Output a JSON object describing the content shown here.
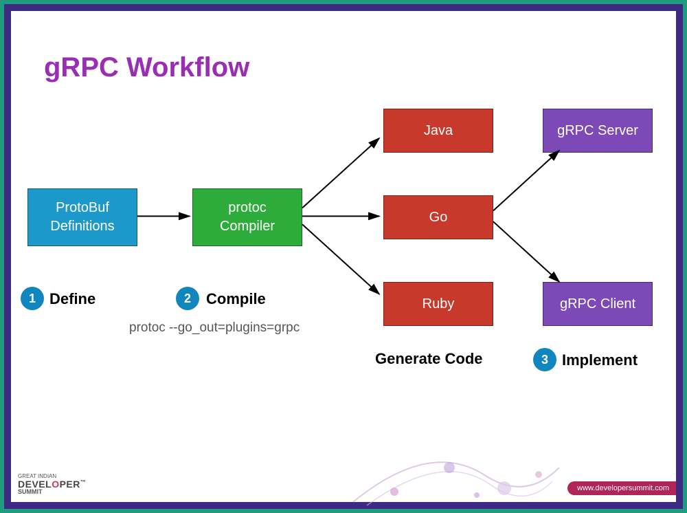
{
  "title": "gRPC Workflow",
  "boxes": {
    "protobuf_l1": "ProtoBuf",
    "protobuf_l2": "Definitions",
    "compiler_l1": "protoc",
    "compiler_l2": "Compiler",
    "java": "Java",
    "go": "Go",
    "ruby": "Ruby",
    "server": "gRPC Server",
    "client": "gRPC Client"
  },
  "steps": {
    "one": "1",
    "one_label": "Define",
    "two": "2",
    "two_label": "Compile",
    "three": "3",
    "three_label": "Implement"
  },
  "generate_label": "Generate Code",
  "command": "protoc --go_out=plugins=grpc",
  "footer": {
    "small": "GREAT INDIAN",
    "brand_pre": "DEVEL",
    "brand_o": "O",
    "brand_post": "PER",
    "sub": "SUMMIT",
    "url": "www.developersummit.com"
  }
}
